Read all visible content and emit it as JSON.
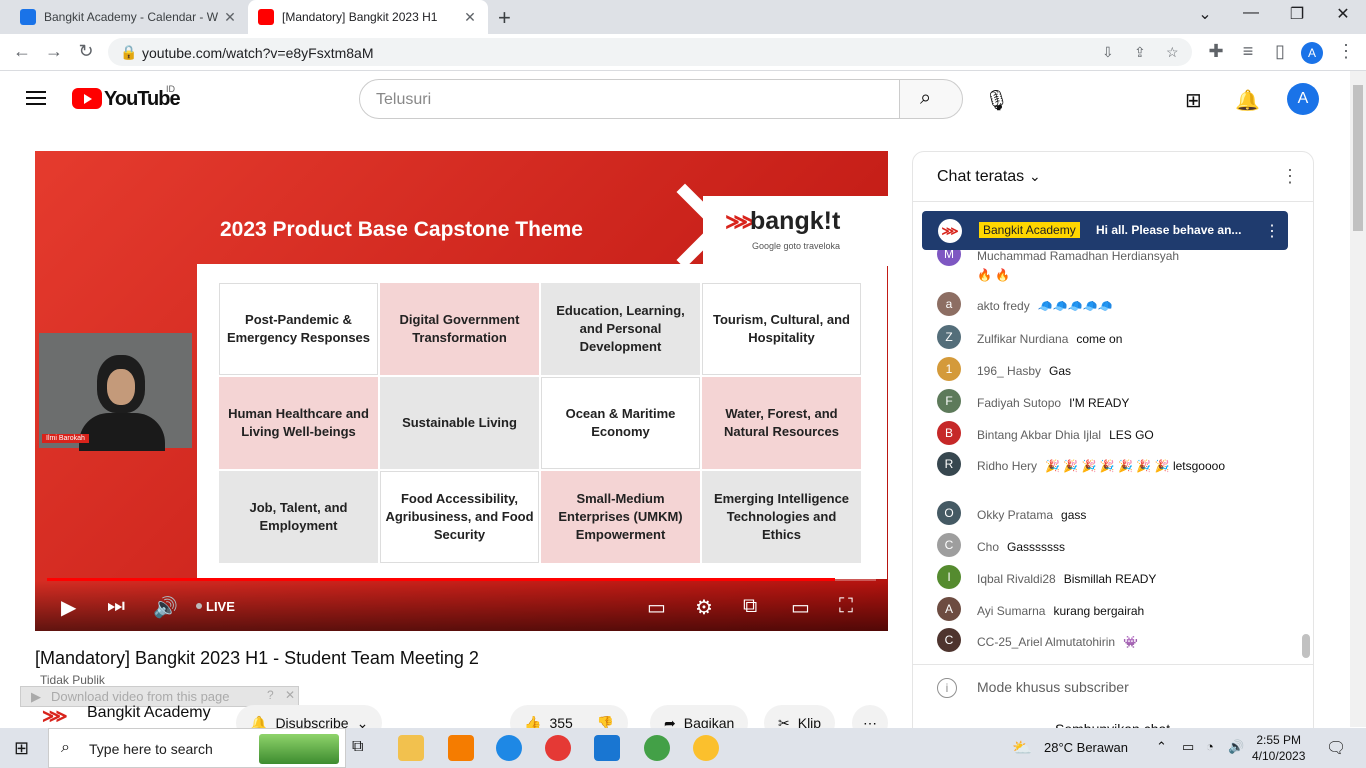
{
  "browser": {
    "tabs": [
      {
        "title": "Bangkit Academy - Calendar - W",
        "favicon_color": "#1a73e8",
        "active": false
      },
      {
        "title": "[Mandatory] Bangkit 2023 H1",
        "favicon_color": "#ff0000",
        "active": true
      }
    ],
    "url": "youtube.com/watch?v=e8yFsxtm8aM",
    "profile_initial": "A"
  },
  "youtube": {
    "logo_text": "YouTube",
    "country": "ID",
    "search_placeholder": "Telusuri",
    "avatar_initial": "A"
  },
  "video": {
    "slide": {
      "title": "2023 Product Base Capstone Theme",
      "brand": "bangk!t",
      "partners": "Google  goto  traveloka",
      "themes": [
        "Post-Pandemic & Emergency Responses",
        "Digital Government Transformation",
        "Education, Learning, and Personal Development",
        "Tourism, Cultural, and Hospitality",
        "Human Healthcare and Living Well-beings",
        "Sustainable Living",
        "Ocean & Maritime Economy",
        "Water, Forest, and Natural Resources",
        "Job, Talent, and Employment",
        "Food Accessibility, Agribusiness, and Food Security",
        "Small-Medium Enterprises (UMKM) Empowerment",
        "Emerging Intelligence Technologies and Ethics"
      ],
      "speaker_name": "Ilmi Barokah"
    },
    "live_label": "LIVE",
    "progress": 0.95,
    "title": "[Mandatory] Bangkit 2023 H1 - Student Team Meeting 2",
    "visibility": "Tidak Publik",
    "download_bar": "Download video from this page",
    "channel": "Bangkit Academy",
    "subscribe_label": "Disubscribe",
    "likes": "355",
    "share_label": "Bagikan",
    "clip_label": "Klip"
  },
  "chat": {
    "header": "Chat teratas",
    "pinned": {
      "badge": "Bangkit Academy",
      "text": "Hi all. Please behave an..."
    },
    "messages": [
      {
        "name": "Muchammad Ramadhan Herdiansyah",
        "text": "🔥 🔥",
        "initial": "M",
        "color": "#7e57c2"
      },
      {
        "name": "akto fredy",
        "text": "🧢🧢🧢🧢🧢",
        "initial": "a",
        "color": "#8d6e63"
      },
      {
        "name": "Zulfikar Nurdiana",
        "text": "come on",
        "initial": "Z",
        "color": "#546e7a"
      },
      {
        "name": "196_ Hasby",
        "text": "Gas",
        "initial": "1",
        "color": "#d49a3a"
      },
      {
        "name": "Fadiyah Sutopo",
        "text": "I'M READY",
        "initial": "F",
        "color": "#5d7a5a"
      },
      {
        "name": "Bintang Akbar Dhia Ijlal",
        "text": "LES GO",
        "initial": "B",
        "color": "#c62828"
      },
      {
        "name": "Ridho Hery",
        "text": "🎉 🎉 🎉 🎉 🎉 🎉 🎉 letsgoooo",
        "initial": "R",
        "color": "#37474f"
      },
      {
        "name": "Okky Pratama",
        "text": "gass",
        "initial": "O",
        "color": "#455a64"
      },
      {
        "name": "Cho",
        "text": "Gasssssss",
        "initial": "C",
        "color": "#9e9e9e"
      },
      {
        "name": "Iqbal Rivaldi28",
        "text": "Bismillah READY",
        "initial": "I",
        "color": "#558b2f"
      },
      {
        "name": "Ayi Sumarna",
        "text": "kurang bergairah",
        "initial": "A",
        "color": "#6d4c41"
      },
      {
        "name": "CC-25_Ariel Almutatohirin",
        "text": "👾",
        "initial": "C",
        "color": "#4e342e"
      }
    ],
    "mode_text": "Mode khusus subscriber",
    "hide_chat": "Sembunyikan chat"
  },
  "taskbar": {
    "search_placeholder": "Type here to search",
    "weather": "28°C  Berawan",
    "time": "2:55 PM",
    "date": "4/10/2023"
  }
}
